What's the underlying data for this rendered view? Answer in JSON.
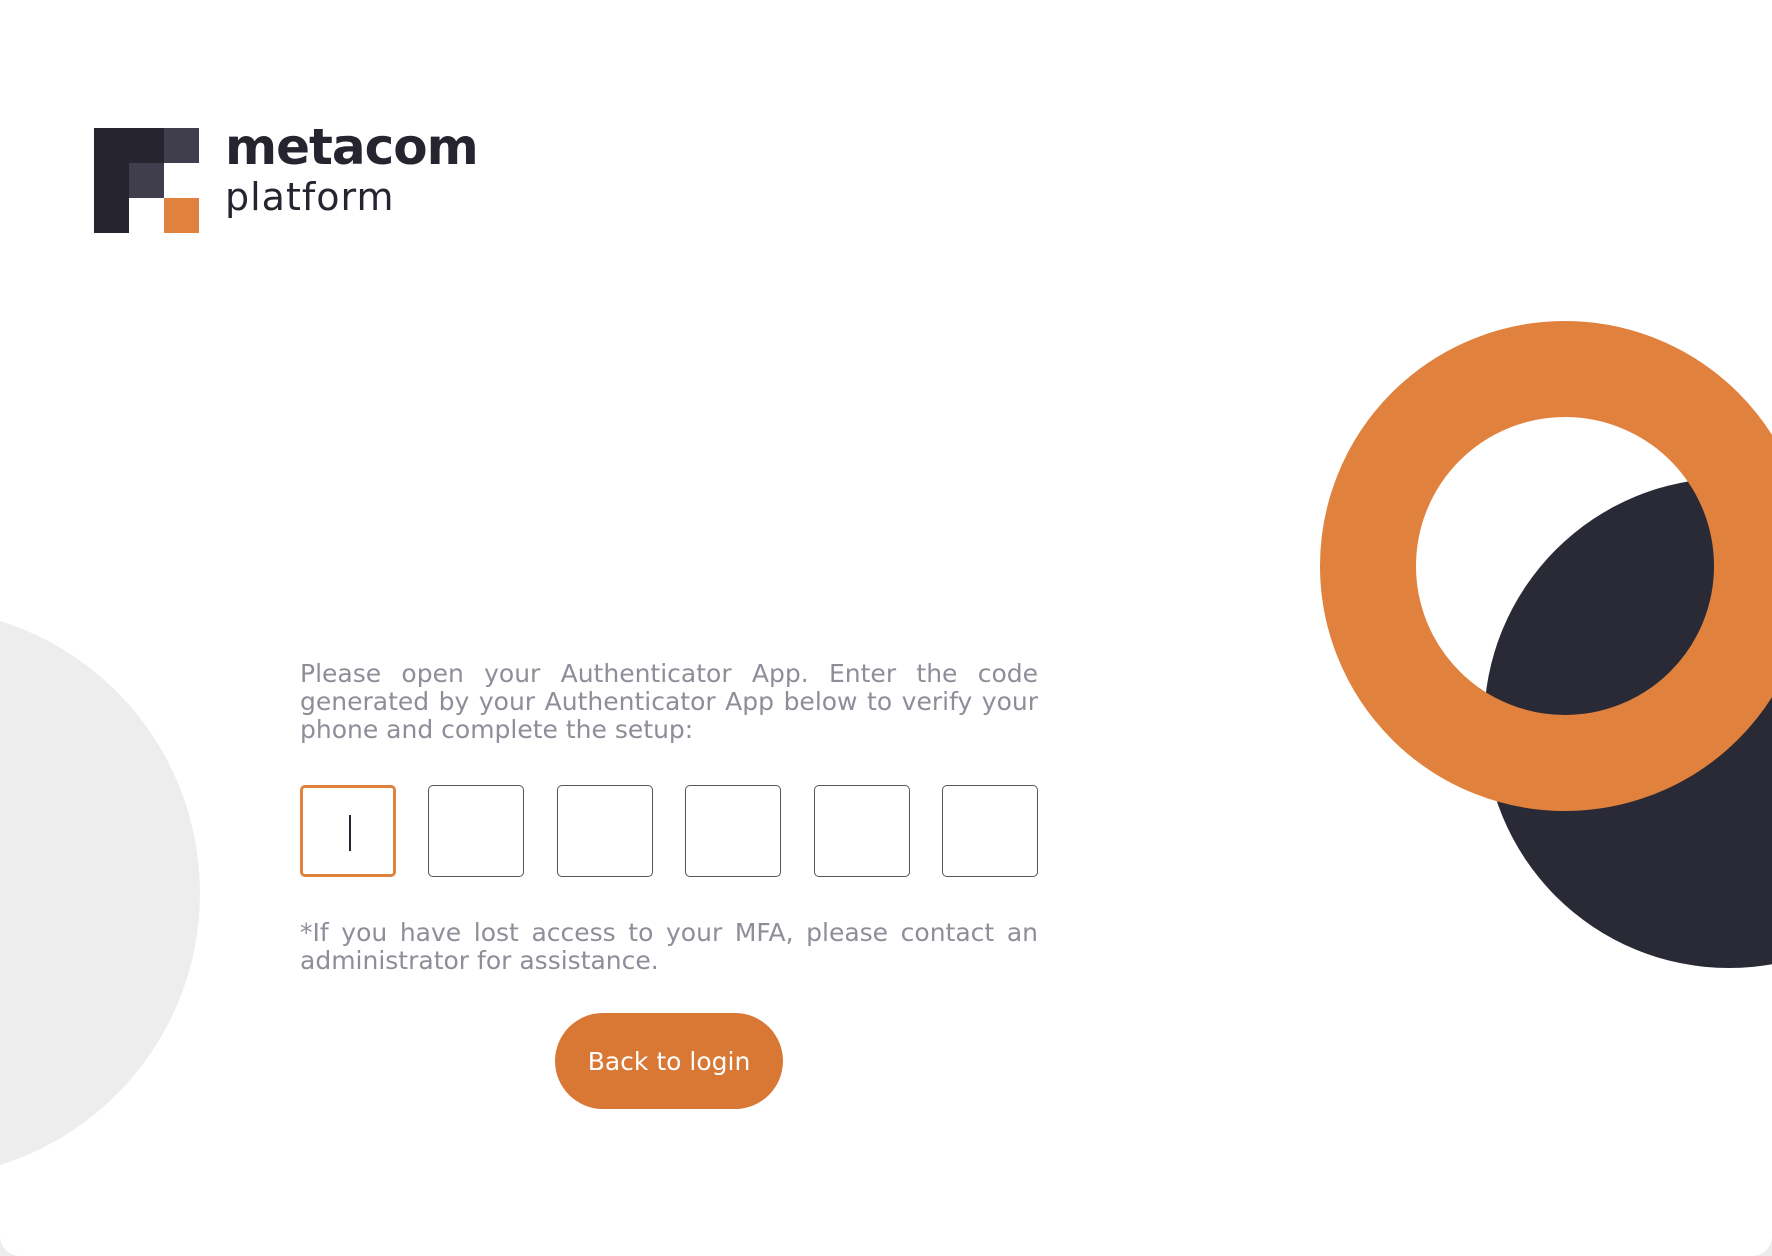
{
  "brand": {
    "name": "metacom",
    "subtitle": "platform",
    "colors": {
      "accent": "#e0823d",
      "dark": "#292a35",
      "text_muted": "#8e8e99"
    }
  },
  "mfa": {
    "instructions": "Please open your Authenticator App. Enter the code generated by your Authenticator App below to verify your phone and complete the setup:",
    "code_digits": [
      "",
      "",
      "",
      "",
      "",
      ""
    ],
    "help_text": "*If you have lost access to your MFA, please contact an administrator for assistance.",
    "back_button_label": "Back to login"
  }
}
